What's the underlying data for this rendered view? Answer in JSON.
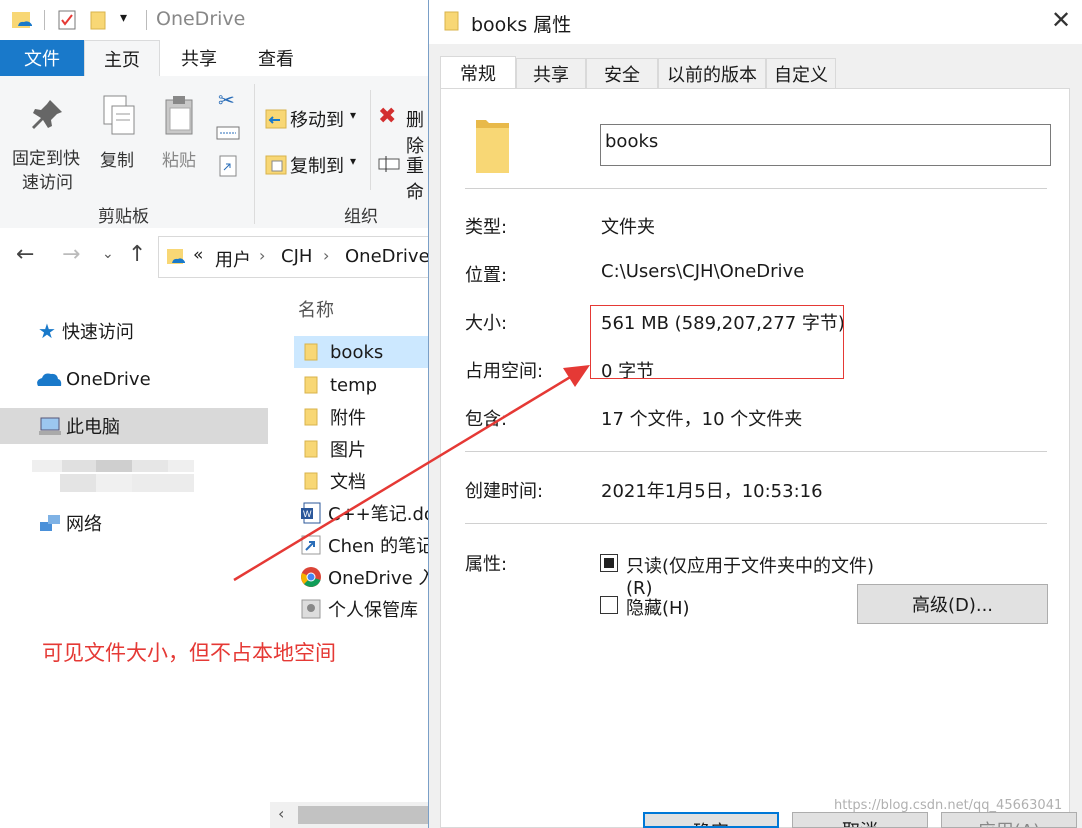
{
  "explorer": {
    "title": "OneDrive",
    "tabs": {
      "file": "文件",
      "home": "主页",
      "share": "共享",
      "view": "查看"
    },
    "ribbon": {
      "pin_line1": "固定到快",
      "pin_line2": "速访问",
      "copy": "复制",
      "paste": "粘贴",
      "move_to": "移动到",
      "copy_to": "复制到",
      "delete": "删除",
      "rename": "重命",
      "group_clipboard": "剪贴板",
      "group_organize": "组织"
    },
    "address": {
      "prefix": "«",
      "parts": [
        "用户",
        "CJH",
        "OneDrive"
      ]
    },
    "nav": {
      "quick_access": "快速访问",
      "onedrive": "OneDrive",
      "this_pc": "此电脑",
      "network": "网络"
    },
    "files": {
      "header_name": "名称",
      "items": [
        "books",
        "temp",
        "附件",
        "图片",
        "文档",
        "C++笔记.do",
        "Chen 的笔记",
        "OneDrive 入",
        "个人保管库"
      ]
    }
  },
  "dialog": {
    "title": "books 属性",
    "tabs": [
      "常规",
      "共享",
      "安全",
      "以前的版本",
      "自定义"
    ],
    "name_value": "books",
    "rows": {
      "type_label": "类型:",
      "type_value": "文件夹",
      "location_label": "位置:",
      "location_value": "C:\\Users\\CJH\\OneDrive",
      "size_label": "大小:",
      "size_value": "561 MB (589,207,277 字节)",
      "disk_label": "占用空间:",
      "disk_value": "0 字节",
      "contains_label": "包含:",
      "contains_value": "17 个文件，10 个文件夹",
      "created_label": "创建时间:",
      "created_value": "2021年1月5日，10:53:16",
      "attributes_label": "属性:"
    },
    "readonly_label": "只读(仅应用于文件夹中的文件)(R)",
    "hidden_label": "隐藏(H)",
    "advanced_button": "高级(D)...",
    "ok_button": "确定",
    "cancel_button": "取消",
    "apply_button": "应用(A)"
  },
  "annotation": {
    "text": "可见文件大小，但不占本地空间",
    "color": "#e53935"
  },
  "watermark": "https://blog.csdn.net/qq_45663041",
  "colors": {
    "accent": "#1979ca",
    "selection": "#cce8ff",
    "folder": "#f8d775"
  }
}
